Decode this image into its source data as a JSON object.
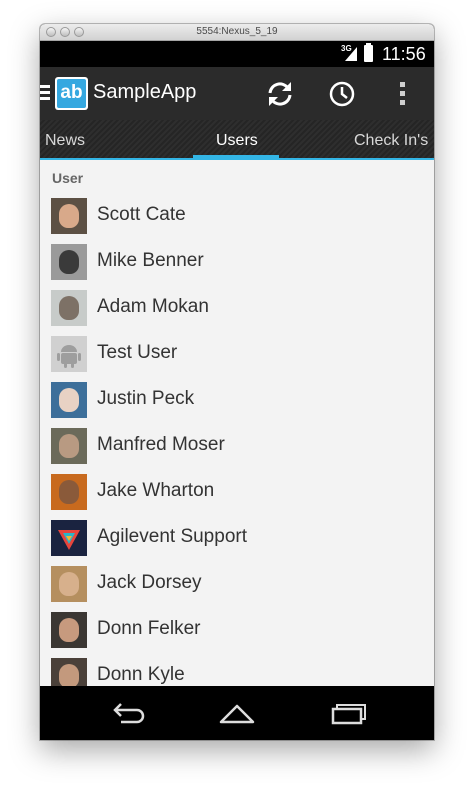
{
  "window": {
    "title": "5554:Nexus_5_19"
  },
  "statusbar": {
    "network": "3G",
    "time": "11:56"
  },
  "actionbar": {
    "app_icon_text": "ab",
    "title": "SampleApp",
    "icons": [
      "refresh-icon",
      "history-clock-icon",
      "overflow-menu-icon"
    ]
  },
  "tabs": [
    {
      "label": "News",
      "selected": false
    },
    {
      "label": "Users",
      "selected": true
    },
    {
      "label": "Check In's",
      "selected": false
    }
  ],
  "section": {
    "header": "User"
  },
  "users": [
    {
      "name": "Scott Cate"
    },
    {
      "name": "Mike Benner"
    },
    {
      "name": "Adam Mokan"
    },
    {
      "name": "Test User"
    },
    {
      "name": "Justin Peck"
    },
    {
      "name": "Manfred Moser"
    },
    {
      "name": "Jake Wharton"
    },
    {
      "name": "Agilevent Support"
    },
    {
      "name": "Jack Dorsey"
    },
    {
      "name": "Donn Felker"
    },
    {
      "name": "Donn Kyle"
    }
  ],
  "navbar": {
    "icons": [
      "back-icon",
      "home-icon",
      "recent-apps-icon"
    ]
  },
  "colors": {
    "accent": "#33b5e5",
    "app_icon": "#35a8e0",
    "actionbar": "#2b2b2b",
    "list_bg": "#f3f3f3"
  }
}
